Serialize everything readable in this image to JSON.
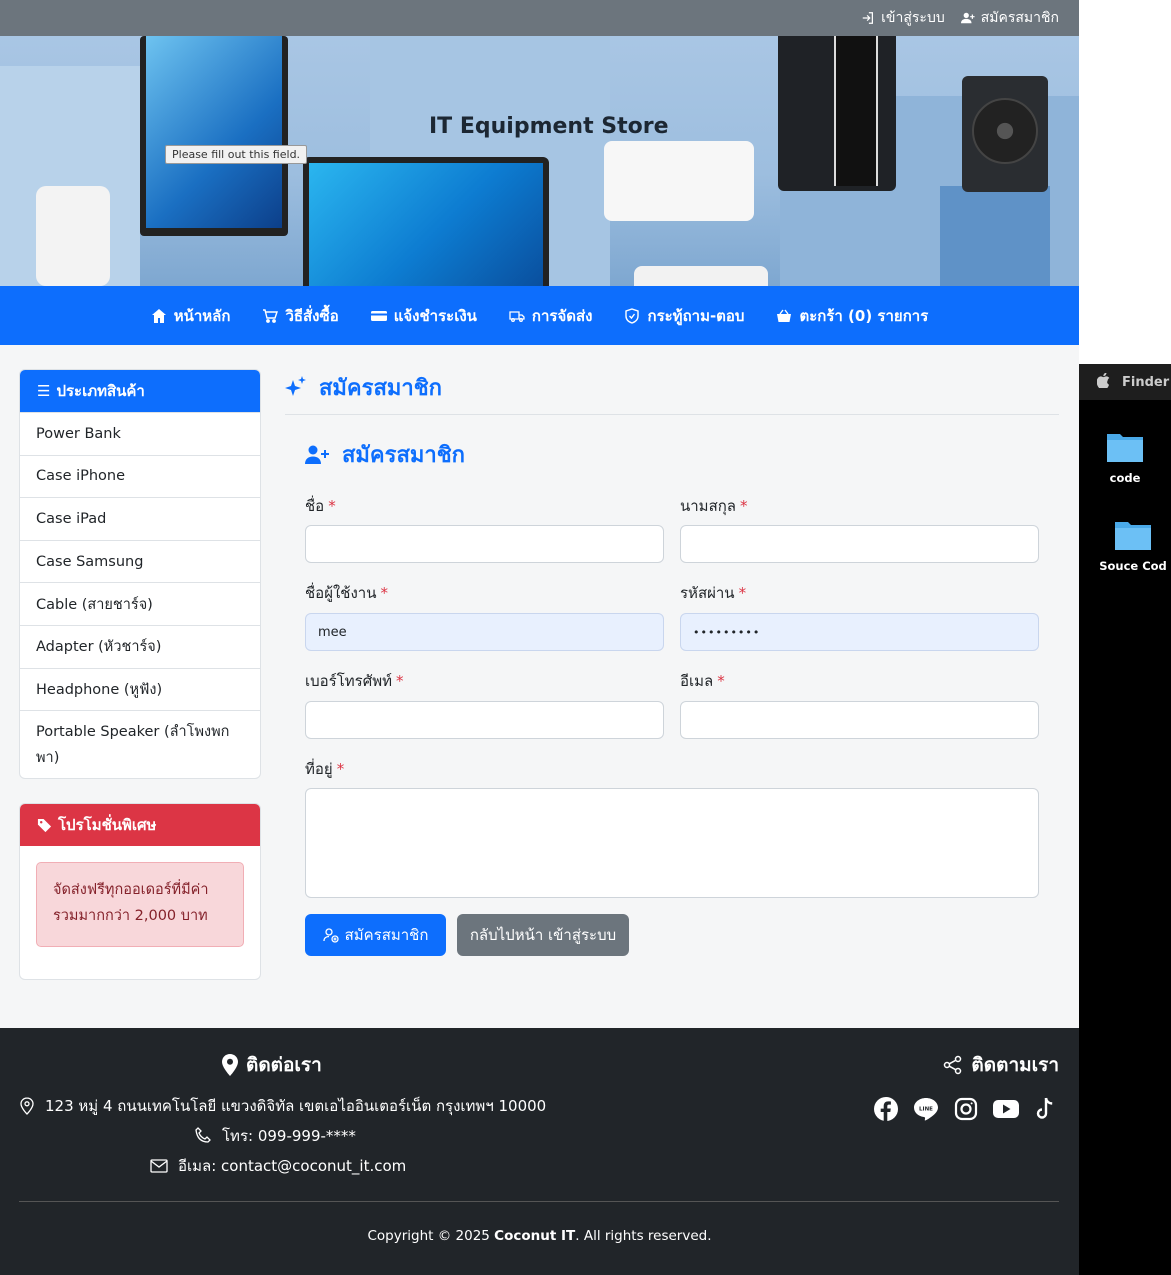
{
  "topbar": {
    "login_label": "เข้าสู่ระบบ",
    "register_label": "สมัครสมาชิก"
  },
  "banner": {
    "title": "IT Equipment Store",
    "tooltip": "Please fill out this field."
  },
  "nav": {
    "items": [
      {
        "label": "หน้าหลัก",
        "icon": "home-icon"
      },
      {
        "label": "วิธีสั่งซื้อ",
        "icon": "cart-icon"
      },
      {
        "label": "แจ้งชำระเงิน",
        "icon": "credit-card-icon"
      },
      {
        "label": "การจัดส่ง",
        "icon": "truck-icon"
      },
      {
        "label": "กระทู้ถาม-ตอบ",
        "icon": "shield-icon"
      },
      {
        "label": "ตะกร้า (0) รายการ",
        "icon": "basket-icon"
      }
    ]
  },
  "sidebar": {
    "categories_title": "ประเภทสินค้า",
    "categories": [
      "Power Bank",
      "Case iPhone",
      "Case iPad",
      "Case Samsung",
      "Cable (สายชาร์จ)",
      "Adapter (หัวชาร์จ)",
      "Headphone (หูฟัง)",
      "Portable Speaker (ลำโพงพกพา)"
    ],
    "promo_title": "โปรโมชั่นพิเศษ",
    "promo_text": "จัดส่งฟรีทุกออเดอร์ที่มีค่ารวมมากกว่า 2,000 บาท"
  },
  "main": {
    "page_title": "สมัครสมาชิก",
    "form_title": "สมัครสมาชิก",
    "required_mark": "*",
    "fields": {
      "first_name": {
        "label": "ชื่อ",
        "value": ""
      },
      "last_name": {
        "label": "นามสกุล",
        "value": ""
      },
      "username": {
        "label": "ชื่อผู้ใช้งาน",
        "value": "mee"
      },
      "password": {
        "label": "รหัสผ่าน",
        "value": "•••••••••"
      },
      "phone": {
        "label": "เบอร์โทรศัพท์",
        "value": ""
      },
      "email": {
        "label": "อีเมล",
        "value": ""
      },
      "address": {
        "label": "ที่อยู่",
        "value": ""
      }
    },
    "submit_label": "สมัครสมาชิก",
    "back_label": "กลับไปหน้า เข้าสู่ระบบ"
  },
  "footer": {
    "contact_title": "ติดต่อเรา",
    "follow_title": "ติดตามเรา",
    "address": "123 หมู่ 4 ถนนเทคโนโลยี แขวงดิจิทัล เขตเอไออินเตอร์เน็ต กรุงเทพฯ 10000",
    "phone": "โทร: 099-999-****",
    "email": "อีเมล: contact@coconut_it.com",
    "socials": [
      "facebook-icon",
      "line-icon",
      "instagram-icon",
      "youtube-icon",
      "tiktok-icon"
    ],
    "line_badge": "LINE",
    "copyright_prefix": "Copyright © 2025 ",
    "copyright_brand": "Coconut IT",
    "copyright_suffix": ". All rights reserved."
  },
  "desktop": {
    "menu_app": "Finder",
    "icons": [
      "code",
      "Souce Cod"
    ]
  },
  "colors": {
    "primary": "#0d6efd",
    "danger": "#dc3545",
    "secondary": "#6c757d",
    "footer": "#212529"
  }
}
